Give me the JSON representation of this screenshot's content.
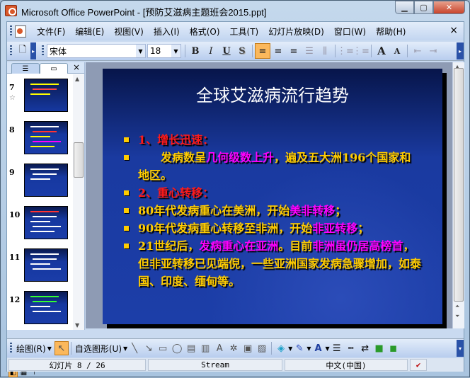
{
  "window": {
    "title": "Microsoft Office PowerPoint - [预防艾滋病主题班会2015.ppt]",
    "minimize": "▁",
    "maximize": "▢",
    "close": "✕"
  },
  "menu": [
    "文件(F)",
    "编辑(E)",
    "视图(V)",
    "插入(I)",
    "格式(O)",
    "工具(T)",
    "幻灯片放映(D)",
    "窗口(W)",
    "帮助(H)"
  ],
  "menu_close": "×",
  "toolbar": {
    "font": "宋体",
    "size": "18",
    "bold": "B",
    "italic": "I",
    "underline": "U",
    "shadow": "S",
    "grow": "A",
    "shrink": "A"
  },
  "outline_tab_icon": "outline-icon",
  "slides_tab_icon": "slides-icon",
  "pane_close": "×",
  "thumbnails": [
    {
      "num": "7",
      "star": "☆"
    },
    {
      "num": "8"
    },
    {
      "num": "9"
    },
    {
      "num": "10"
    },
    {
      "num": "11"
    },
    {
      "num": "12"
    }
  ],
  "slide": {
    "title": "全球艾滋病流行趋势",
    "bullets": [
      [
        {
          "t": "1、增长迅速：",
          "c": "#ff1a1a"
        }
      ],
      [
        {
          "t": "　　发病数呈",
          "c": "#ffcc00"
        },
        {
          "t": "几何级数上升",
          "c": "#ff00ff"
        },
        {
          "t": "，遍及五大洲196个国家和地区。",
          "c": "#ffcc00"
        }
      ],
      [
        {
          "t": "2、重心转移：",
          "c": "#ff1a1a"
        }
      ],
      [
        {
          "t": "80年代发病重心在美洲，开始",
          "c": "#ffcc00"
        },
        {
          "t": "美非转移",
          "c": "#ff00ff"
        },
        {
          "t": "；",
          "c": "#ffcc00"
        }
      ],
      [
        {
          "t": "90年代发病重心转移至非洲，开始",
          "c": "#ffcc00"
        },
        {
          "t": "非亚转移",
          "c": "#ff00ff"
        },
        {
          "t": "；",
          "c": "#ffcc00"
        }
      ],
      [
        {
          "t": "21世纪后，",
          "c": "#ffcc00"
        },
        {
          "t": "发病重心在亚洲",
          "c": "#ff00ff"
        },
        {
          "t": "。目前",
          "c": "#ffcc00"
        },
        {
          "t": "非洲虽仍居高榜首",
          "c": "#ff00ff"
        },
        {
          "t": "，但非亚转移已见端倪，一些亚洲国家发病急骤增加，如泰国、印度、缅甸等。",
          "c": "#ffcc00"
        }
      ]
    ]
  },
  "drawbar": {
    "draw": "绘图(R)",
    "autoshapes": "自选图形(U)"
  },
  "status": {
    "slide": "幻灯片 8 / 26",
    "design": "Stream",
    "language": "中文(中国)"
  }
}
